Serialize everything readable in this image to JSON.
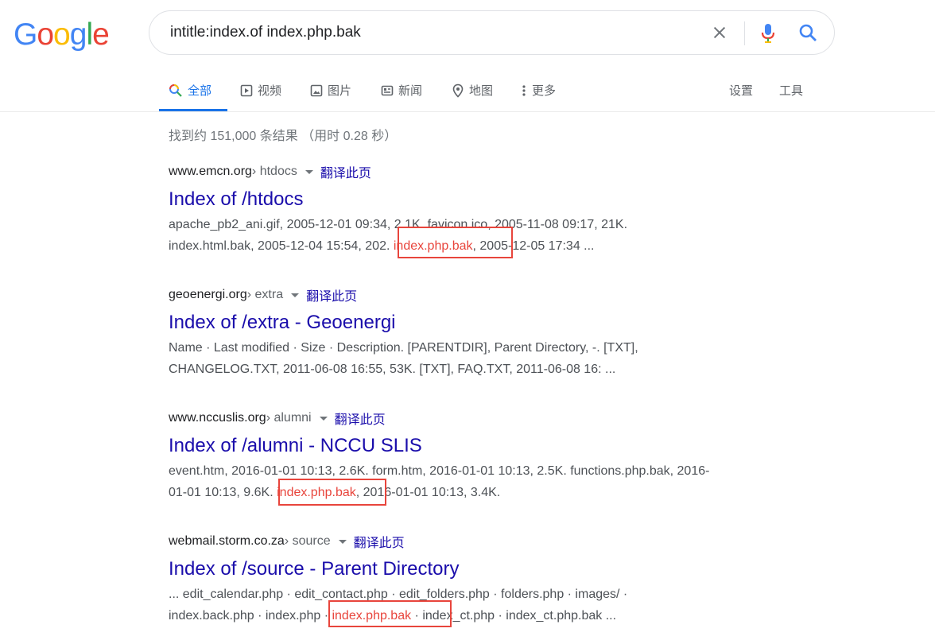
{
  "logo": {
    "letters": [
      "G",
      "o",
      "o",
      "g",
      "l",
      "e"
    ],
    "colors": [
      "#4285F4",
      "#EA4335",
      "#FBBC05",
      "#4285F4",
      "#34A853",
      "#EA4335"
    ]
  },
  "search": {
    "query": "intitle:index.of index.php.bak"
  },
  "tabs": [
    {
      "label": "全部",
      "icon": "search-icon",
      "active": true
    },
    {
      "label": "视频",
      "icon": "video-icon"
    },
    {
      "label": "图片",
      "icon": "image-icon"
    },
    {
      "label": "新闻",
      "icon": "news-icon"
    },
    {
      "label": "地图",
      "icon": "map-pin-icon"
    },
    {
      "label": "更多",
      "icon": "more-vert-icon"
    }
  ],
  "tools": {
    "settings": "设置",
    "tools": "工具"
  },
  "stats": "找到约 151,000 条结果 （用时 0.28 秒）",
  "results": [
    {
      "domain": "www.emcn.org",
      "path": " › htdocs",
      "translate": "翻译此页",
      "title": "Index of /htdocs",
      "line1": "apache_pb2_ani.gif, 2005-12-01 09:34, 2.1K. favicon.ico, 2005-11-08 09:17, 21K.",
      "line2_pre": "index.html.bak, 2005-12-04 15:54, 202. ",
      "line2_hl": "index.php.bak",
      "line2_post": ", 2005-12-05 17:34 ..."
    },
    {
      "domain": "geoenergi.org",
      "path": " › extra",
      "translate": "翻译此页",
      "title": "Index of /extra - Geoenergi",
      "line1": "Name · Last modified · Size · Description. [PARENTDIR], Parent Directory, -. [TXT],",
      "line2": "CHANGELOG.TXT, 2011-06-08 16:55, 53K. [TXT], FAQ.TXT, 2011-06-08 16: ..."
    },
    {
      "domain": "www.nccuslis.org",
      "path": " › alumni",
      "translate": "翻译此页",
      "title": "Index of /alumni - NCCU SLIS",
      "line1": "event.htm, 2016-01-01 10:13, 2.6K. form.htm, 2016-01-01 10:13, 2.5K. functions.php.bak, 2016-",
      "line2_pre": "01-01 10:13, 9.6K. ",
      "line2_hl": "index.php.bak",
      "line2_post": ", 2016-01-01 10:13, 3.4K."
    },
    {
      "domain": "webmail.storm.co.za",
      "path": " › source",
      "translate": "翻译此页",
      "title": "Index of /source - Parent Directory",
      "line1": "... edit_calendar.php · edit_contact.php · edit_folders.php · folders.php · images/ ·",
      "line2_pre": "index.back.php · index.php · ",
      "line2_hl": "index.php.bak",
      "line2_post": " · index_ct.php · index_ct.php.bak ..."
    }
  ]
}
